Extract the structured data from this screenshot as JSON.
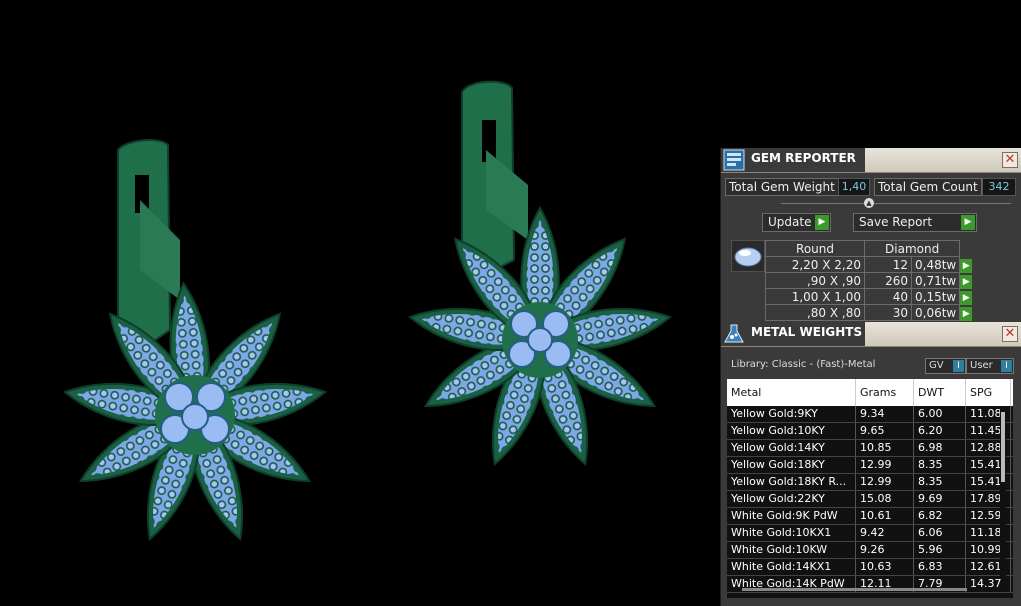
{
  "gem_reporter": {
    "title": "GEM REPORTER",
    "total_weight_label": "Total Gem Weight",
    "total_weight_value": "1,40",
    "total_count_label": "Total Gem Count",
    "total_count_value": "342",
    "update_label": "Update",
    "save_label": "Save Report",
    "shape": "Round",
    "material": "Diamond",
    "rows": [
      {
        "size": "2,20 X 2,20",
        "count": "12",
        "weight": "0,48tw"
      },
      {
        "size": ",90 X ,90",
        "count": "260",
        "weight": "0,71tw"
      },
      {
        "size": "1,00 X 1,00",
        "count": "40",
        "weight": "0,15tw"
      },
      {
        "size": ",80 X ,80",
        "count": "30",
        "weight": "0,06tw"
      }
    ]
  },
  "metal_weights": {
    "title": "METAL WEIGHTS",
    "library": "Library: Classic - (Fast)-Metal",
    "gv_label": "GV",
    "user_label": "User",
    "columns": [
      "Metal",
      "Grams",
      "DWT",
      "SPG"
    ],
    "rows": [
      {
        "metal": "Yellow Gold:9KY",
        "grams": "9.34",
        "dwt": "6.00",
        "spg": "11.08"
      },
      {
        "metal": "Yellow Gold:10KY",
        "grams": "9.65",
        "dwt": "6.20",
        "spg": "11.45"
      },
      {
        "metal": "Yellow Gold:14KY",
        "grams": "10.85",
        "dwt": "6.98",
        "spg": "12.88"
      },
      {
        "metal": "Yellow Gold:18KY",
        "grams": "12.99",
        "dwt": "8.35",
        "spg": "15.41"
      },
      {
        "metal": "Yellow Gold:18KY R...",
        "grams": "12.99",
        "dwt": "8.35",
        "spg": "15.41"
      },
      {
        "metal": "Yellow Gold:22KY",
        "grams": "15.08",
        "dwt": "9.69",
        "spg": "17.89"
      },
      {
        "metal": "White Gold:9K PdW",
        "grams": "10.61",
        "dwt": "6.82",
        "spg": "12.59"
      },
      {
        "metal": "White Gold:10KX1",
        "grams": "9.42",
        "dwt": "6.06",
        "spg": "11.18"
      },
      {
        "metal": "White Gold:10KW",
        "grams": "9.26",
        "dwt": "5.96",
        "spg": "10.99"
      },
      {
        "metal": "White Gold:14KX1",
        "grams": "10.63",
        "dwt": "6.83",
        "spg": "12.61"
      },
      {
        "metal": "White Gold:14K PdW",
        "grams": "12.11",
        "dwt": "7.79",
        "spg": "14.37"
      }
    ]
  },
  "colors": {
    "metal_green": "#1f6f4a",
    "gem_blue": "#8fb6ee",
    "accent_green": "#3c9a2d",
    "value_blue": "#7ec8e3"
  }
}
